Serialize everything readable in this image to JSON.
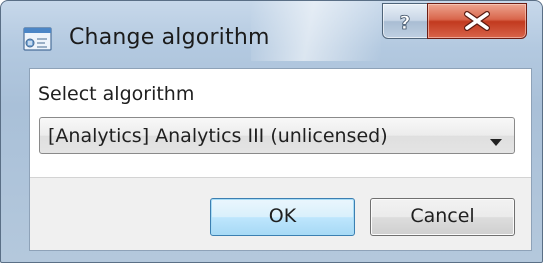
{
  "window": {
    "title": "Change algorithm",
    "title_icon": "app-window-icon",
    "help_icon": "help-question-icon",
    "close_icon": "close-x-icon"
  },
  "form": {
    "label": "Select algorithm",
    "selected_value": "[Analytics] Analytics III (unlicensed)",
    "arrow_icon": "dropdown-arrow-icon"
  },
  "buttons": {
    "ok": "OK",
    "cancel": "Cancel"
  },
  "colors": {
    "close_button": "#c94a2e",
    "ok_focus_border": "#3c7fb1"
  }
}
